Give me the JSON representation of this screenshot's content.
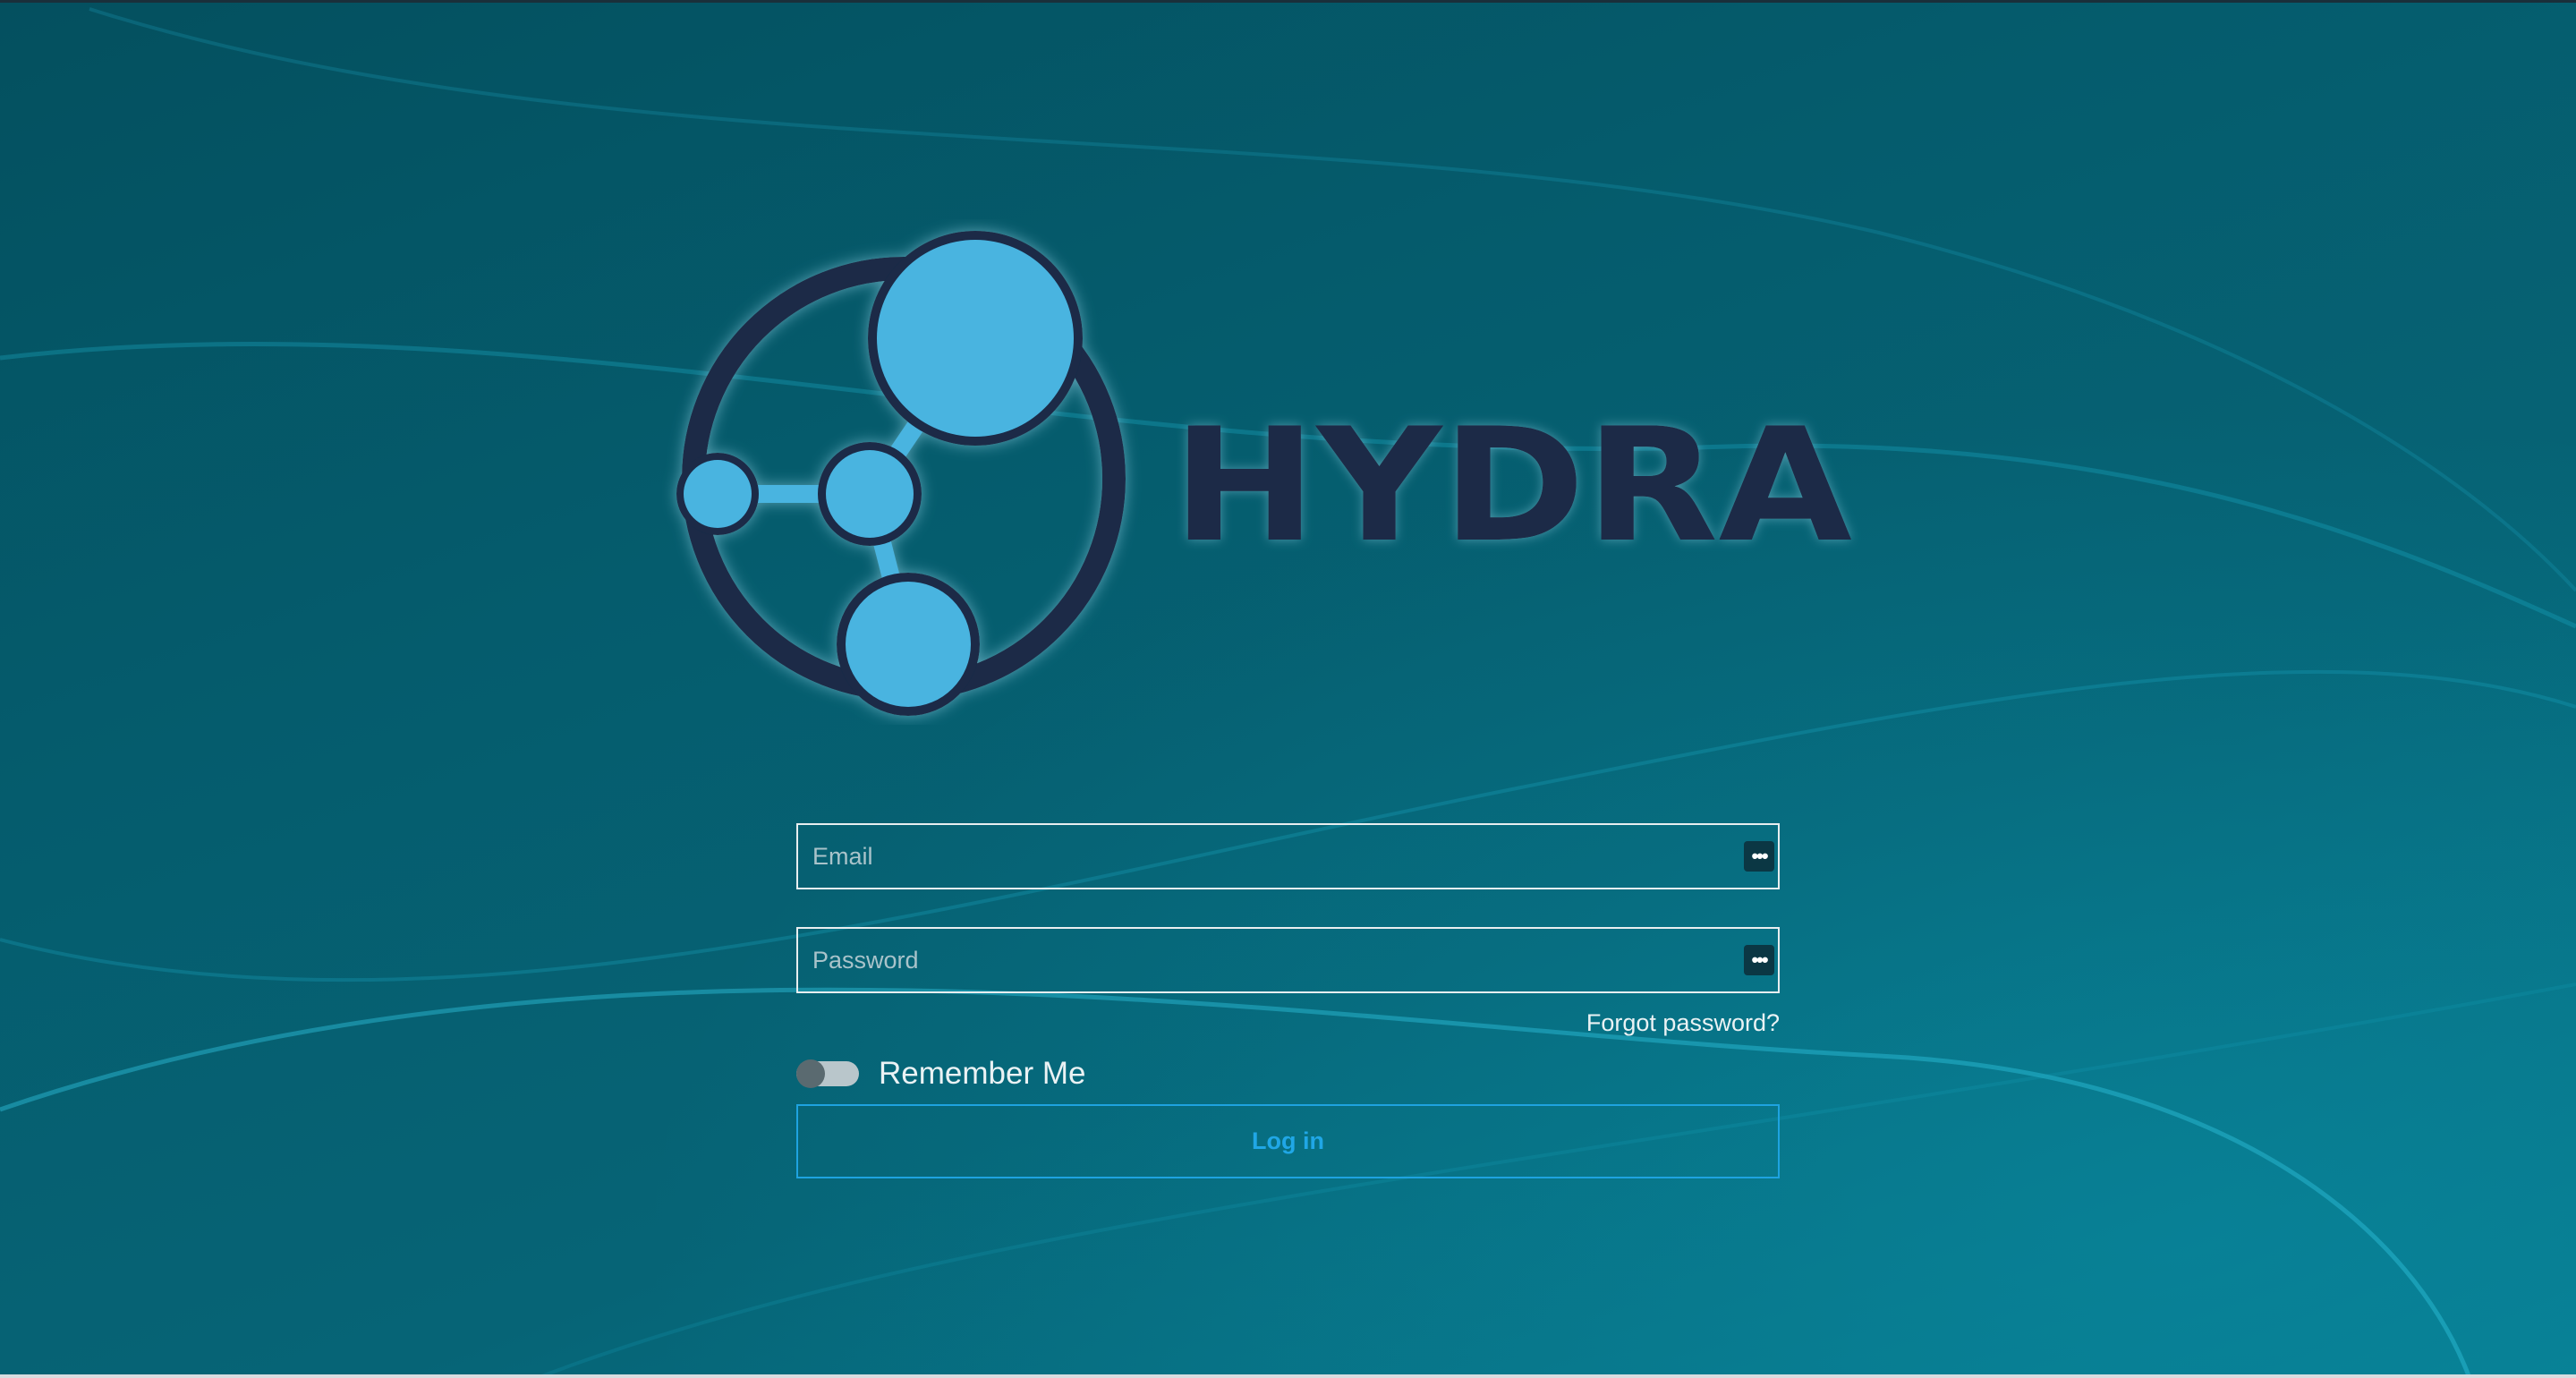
{
  "brand": {
    "name": "HYDRA",
    "logo_icon": "molecule-icon",
    "colors": {
      "logo_blue": "#4ab4e0",
      "logo_dark": "#1a2a47",
      "accent": "#1ea3e0"
    }
  },
  "login_form": {
    "email": {
      "placeholder": "Email",
      "value": "",
      "icon": "password-manager-icon"
    },
    "password": {
      "placeholder": "Password",
      "value": "",
      "icon": "password-manager-icon"
    },
    "forgot_password_label": "Forgot password?",
    "remember_me": {
      "label": "Remember Me",
      "checked": false
    },
    "submit_label": "Log in"
  }
}
